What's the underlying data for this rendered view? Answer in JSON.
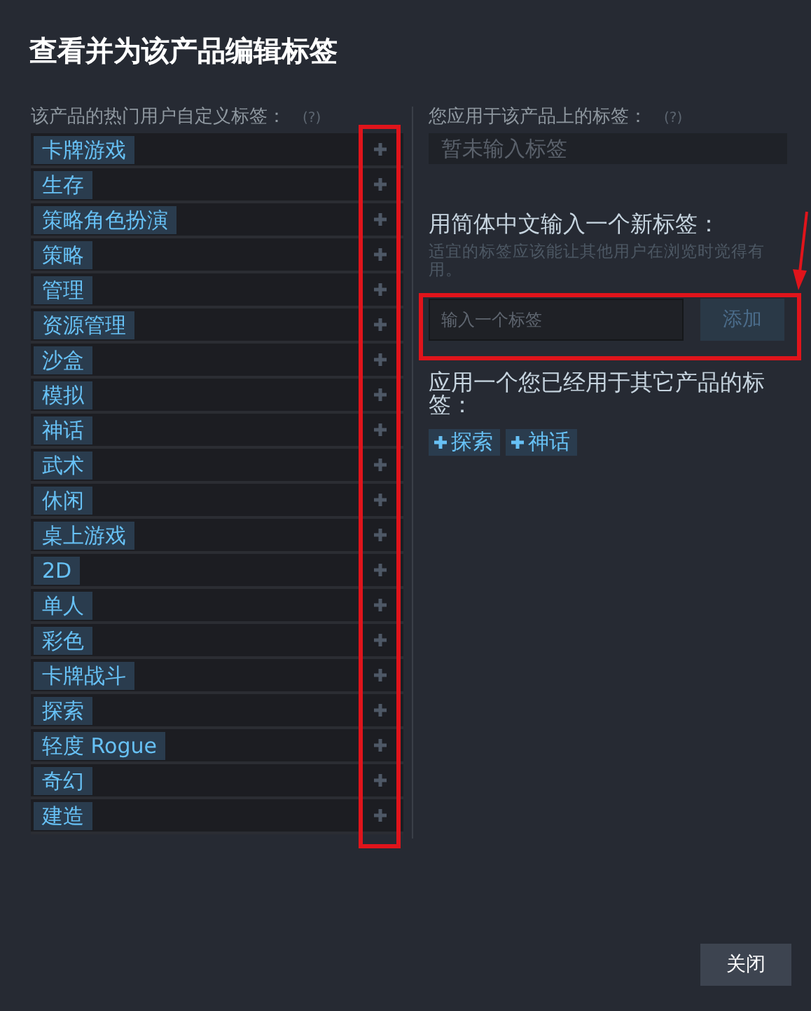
{
  "title": "查看并为该产品编辑标签",
  "popular": {
    "label": "该产品的热门用户自定义标签：",
    "help": "(?)",
    "tags": [
      "卡牌游戏",
      "生存",
      "策略角色扮演",
      "策略",
      "管理",
      "资源管理",
      "沙盒",
      "模拟",
      "神话",
      "武术",
      "休闲",
      "桌上游戏",
      "2D",
      "单人",
      "彩色",
      "卡牌战斗",
      "探索",
      "轻度 Rogue",
      "奇幻",
      "建造"
    ]
  },
  "applied": {
    "label": "您应用于该产品上的标签：",
    "help": "(?)",
    "empty_text": "暂未输入标签"
  },
  "new_tag": {
    "heading": "用简体中文输入一个新标签：",
    "hint": "适宜的标签应该能让其他用户在浏览时觉得有用。",
    "placeholder": "输入一个标签",
    "button": "添加"
  },
  "used_tags": {
    "heading": "应用一个您已经用于其它产品的标签：",
    "tags": [
      "探索",
      "神话"
    ]
  },
  "close_button": "关闭"
}
